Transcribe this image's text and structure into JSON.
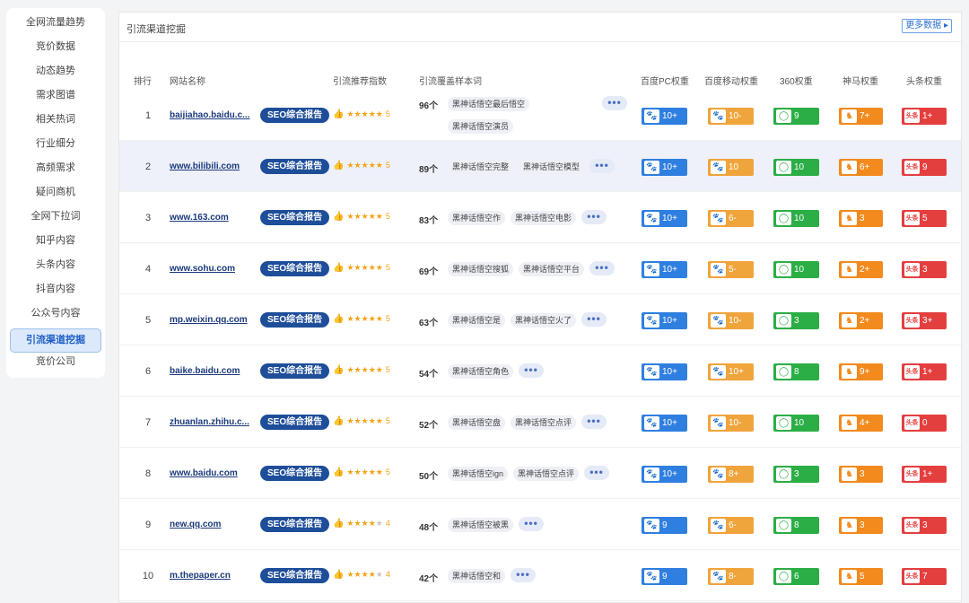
{
  "sidebar": {
    "items": [
      {
        "label": "全网流量趋势",
        "active": false
      },
      {
        "label": "竞价数据",
        "active": false
      },
      {
        "label": "动态趋势",
        "active": false
      },
      {
        "label": "需求图谱",
        "active": false
      },
      {
        "label": "相关热词",
        "active": false
      },
      {
        "label": "行业细分",
        "active": false
      },
      {
        "label": "高频需求",
        "active": false
      },
      {
        "label": "疑问商机",
        "active": false
      },
      {
        "label": "全网下拉词",
        "active": false
      },
      {
        "label": "知乎内容",
        "active": false
      },
      {
        "label": "头条内容",
        "active": false
      },
      {
        "label": "抖音内容",
        "active": false
      },
      {
        "label": "公众号内容",
        "active": false
      },
      {
        "label": "引流渠道挖掘",
        "active": true
      },
      {
        "label": "竞价公司",
        "active": false
      }
    ]
  },
  "panel": {
    "title": "引流渠道挖掘",
    "more_label": "更多数据 ▸"
  },
  "table": {
    "headers": {
      "rank": "排行",
      "site": "网站名称",
      "index": "引流推荐指数",
      "keywords": "引流覆盖样本词",
      "pc": "百度PC权重",
      "mobile": "百度移动权重",
      "w360": "360权重",
      "shenma": "神马权重",
      "toutiao": "头条权重"
    },
    "report_label": "SEO综合报告",
    "more_dots": "•••",
    "icons": {
      "pc": "baidu-paw-icon",
      "mobile": "baidu-paw-icon",
      "w360": "360-ring-icon",
      "shenma": "shenma-icon",
      "toutiao": "toutiao-icon"
    },
    "toutiao_icon_text": "头条",
    "rows": [
      {
        "rank": "1",
        "site": "baijiahao.baidu.c...",
        "stars": 5,
        "score": "5",
        "count": "96个",
        "tags": [
          "黑神话悟空最后悟空",
          "黑神话悟空演员"
        ],
        "pc": "10+",
        "mobile": "10-",
        "w360": "9",
        "shenma": "7+",
        "toutiao": "1+"
      },
      {
        "rank": "2",
        "site": "www.bilibili.com",
        "stars": 5,
        "score": "5",
        "count": "89个",
        "tags": [
          "黑神话悟空完整",
          "黑神话悟空模型"
        ],
        "pc": "10+",
        "mobile": "10",
        "w360": "10",
        "shenma": "6+",
        "toutiao": "9"
      },
      {
        "rank": "3",
        "site": "www.163.com",
        "stars": 5,
        "score": "5",
        "count": "83个",
        "tags": [
          "黑神话悟空作",
          "黑神话悟空电影"
        ],
        "pc": "10+",
        "mobile": "6-",
        "w360": "10",
        "shenma": "3",
        "toutiao": "5"
      },
      {
        "rank": "4",
        "site": "www.sohu.com",
        "stars": 5,
        "score": "5",
        "count": "69个",
        "tags": [
          "黑神话悟空搜狐",
          "黑神话悟空平台"
        ],
        "pc": "10+",
        "mobile": "5-",
        "w360": "10",
        "shenma": "2+",
        "toutiao": "3"
      },
      {
        "rank": "5",
        "site": "mp.weixin.qq.com",
        "stars": 5,
        "score": "5",
        "count": "63个",
        "tags": [
          "黑神话悟空是",
          "黑神话悟空火了"
        ],
        "pc": "10+",
        "mobile": "10-",
        "w360": "3",
        "shenma": "2+",
        "toutiao": "3+"
      },
      {
        "rank": "6",
        "site": "baike.baidu.com",
        "stars": 5,
        "score": "5",
        "count": "54个",
        "tags": [
          "黑神话悟空角色"
        ],
        "pc": "10+",
        "mobile": "10+",
        "w360": "8",
        "shenma": "9+",
        "toutiao": "1+"
      },
      {
        "rank": "7",
        "site": "zhuanlan.zhihu.c...",
        "stars": 5,
        "score": "5",
        "count": "52个",
        "tags": [
          "黑神话悟空盘",
          "黑神话悟空点评"
        ],
        "pc": "10+",
        "mobile": "10-",
        "w360": "10",
        "shenma": "4+",
        "toutiao": "0"
      },
      {
        "rank": "8",
        "site": "www.baidu.com",
        "stars": 5,
        "score": "5",
        "count": "50个",
        "tags": [
          "黑神话悟空ign",
          "黑神话悟空点评"
        ],
        "pc": "10+",
        "mobile": "8+",
        "w360": "3",
        "shenma": "3",
        "toutiao": "1+"
      },
      {
        "rank": "9",
        "site": "new.qq.com",
        "stars": 4,
        "score": "4",
        "count": "48个",
        "tags": [
          "黑神话悟空被黑"
        ],
        "pc": "9",
        "mobile": "6-",
        "w360": "8",
        "shenma": "3",
        "toutiao": "3"
      },
      {
        "rank": "10",
        "site": "m.thepaper.cn",
        "stars": 4,
        "score": "4",
        "count": "42个",
        "tags": [
          "黑神话悟空和"
        ],
        "pc": "9",
        "mobile": "8-",
        "w360": "6",
        "shenma": "5",
        "toutiao": "7"
      }
    ]
  }
}
